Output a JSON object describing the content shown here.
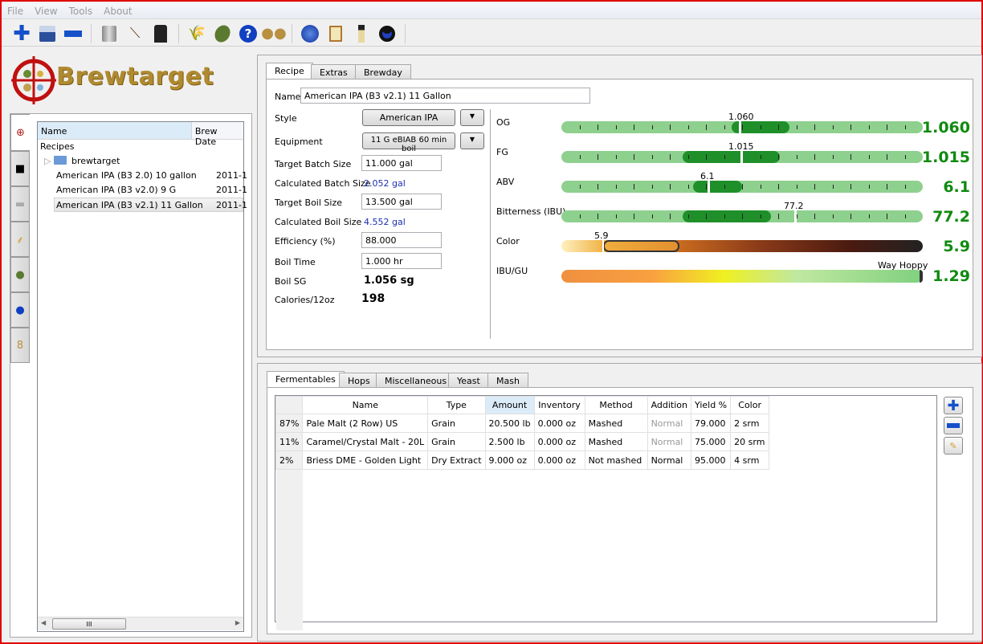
{
  "menu": [
    "File",
    "View",
    "Tools",
    "About"
  ],
  "toolbar": [
    "new-recipe-icon",
    "save-icon",
    "remove-icon",
    "equipment-icon",
    "paddle-icon",
    "style-icon",
    "fermentables-icon",
    "hops-icon",
    "help-icon",
    "yeast-icon",
    "timer-icon",
    "clipboard-icon",
    "hydrometer-icon",
    "refractometer-icon"
  ],
  "logo": {
    "text": "Brewtarget"
  },
  "tree": {
    "col_name": "Name",
    "col_date": "Brew Date",
    "root": "Recipes",
    "folder": "brewtarget",
    "recipes": [
      {
        "name": "American IPA (B3 2.0) 10 gallon",
        "date": "2011-1"
      },
      {
        "name": "American IPA (B3 v2.0) 9 G",
        "date": "2011-1"
      },
      {
        "name": "American IPA (B3 v2.1) 11 Gallon",
        "date": "2011-1"
      }
    ],
    "scroll_grip": "III"
  },
  "top_tabs": [
    "Recipe",
    "Extras",
    "Brewday"
  ],
  "recipe": {
    "name_label": "Name",
    "name": "American IPA (B3 v2.1) 11 Gallon",
    "style_label": "Style",
    "style": "American IPA",
    "equipment_label": "Equipment",
    "equipment": "11 G  eBIAB 60 min boil",
    "target_batch_label": "Target Batch Size",
    "target_batch": "11.000 gal",
    "calc_batch_label": "Calculated Batch Size",
    "calc_batch": "2.052 gal",
    "target_boil_label": "Target Boil Size",
    "target_boil": "13.500 gal",
    "calc_boil_label": "Calculated Boil Size",
    "calc_boil": "4.552 gal",
    "eff_label": "Efficiency (%)",
    "eff": "88.000",
    "boil_time_label": "Boil Time",
    "boil_time": "1.000 hr",
    "boil_sg_label": "Boil SG",
    "boil_sg": "1.056 sg",
    "cal_label": "Calories/12oz",
    "cal": "198"
  },
  "gauges": {
    "og": {
      "label": "OG",
      "marker": "1.060",
      "value": "1.060"
    },
    "fg": {
      "label": "FG",
      "marker": "1.015",
      "value": "1.015"
    },
    "abv": {
      "label": "ABV",
      "marker": "6.1",
      "value": "6.1"
    },
    "ibu": {
      "label": "Bitterness (IBU)",
      "marker": "77.2",
      "value": "77.2"
    },
    "color": {
      "label": "Color",
      "marker": "5.9",
      "value": "5.9"
    },
    "ibugu": {
      "label": "IBU/GU",
      "marker": "Way Hoppy",
      "value": "1.29"
    }
  },
  "bottom_tabs": [
    "Fermentables",
    "Hops",
    "Miscellaneous",
    "Yeast",
    "Mash"
  ],
  "fermentables": {
    "columns": [
      "Name",
      "Type",
      "Amount",
      "Inventory",
      "Method",
      "Addition",
      "Yield %",
      "Color"
    ],
    "rows": [
      {
        "pct": "87%",
        "cells": [
          "Pale Malt (2 Row) US",
          "Grain",
          "20.500 lb",
          "0.000 oz",
          "Mashed",
          "Normal",
          "79.000",
          "2 srm"
        ]
      },
      {
        "pct": "11%",
        "cells": [
          "Caramel/Crystal Malt - 20L",
          "Grain",
          "2.500 lb",
          "0.000 oz",
          "Mashed",
          "Normal",
          "75.000",
          "20 srm"
        ]
      },
      {
        "pct": "2%",
        "cells": [
          "Briess DME - Golden Light",
          "Dry Extract",
          "9.000 oz",
          "0.000 oz",
          "Not mashed",
          "Normal",
          "95.000",
          "4 srm"
        ]
      }
    ]
  },
  "colors": {
    "good": "#108a10",
    "range": "#1f8f2a",
    "bar": "#8ed08e",
    "border": "#e00000"
  }
}
